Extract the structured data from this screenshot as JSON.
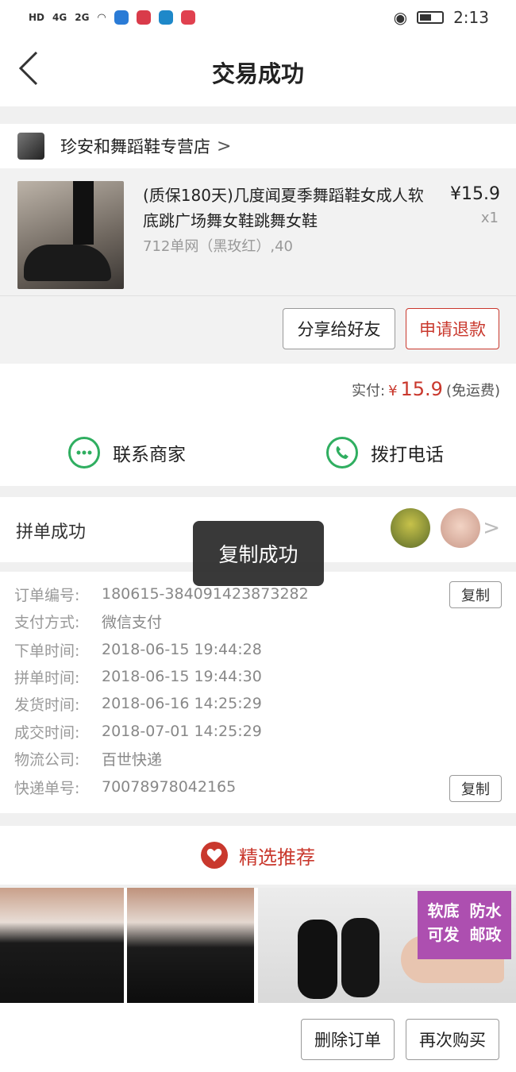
{
  "status_bar": {
    "left_tags": [
      "HD",
      "4G",
      "2G"
    ],
    "time": "2:13"
  },
  "nav": {
    "title": "交易成功"
  },
  "store": {
    "name": "珍安和舞蹈鞋专营店",
    "chevron": ">"
  },
  "product": {
    "title": "(质保180天)几度闻夏季舞蹈鞋女成人软底跳广场舞女鞋跳舞女鞋",
    "spec": "712单网（黑玫红）,40",
    "price": "¥15.9",
    "qty": "x1",
    "share_btn": "分享给好友",
    "refund_btn": "申请退款"
  },
  "payment": {
    "label": "实付:",
    "currency": "¥",
    "amount": "15.9",
    "note": "(免运费)"
  },
  "contact": {
    "merchant": "联系商家",
    "call": "拨打电话"
  },
  "group": {
    "label": "拼单成功",
    "chevron": ">"
  },
  "toast": "复制成功",
  "details": {
    "order_no_label": "订单编号:",
    "order_no": "180615-384091423873282",
    "pay_method_label": "支付方式:",
    "pay_method": "微信支付",
    "order_time_label": "下单时间:",
    "order_time": "2018-06-15 19:44:28",
    "group_time_label": "拼单时间:",
    "group_time": "2018-06-15 19:44:30",
    "ship_time_label": "发货时间:",
    "ship_time": "2018-06-16 14:25:29",
    "deal_time_label": "成交时间:",
    "deal_time": "2018-07-01 14:25:29",
    "logistics_label": "物流公司:",
    "logistics": "百世快递",
    "tracking_label": "快递单号:",
    "tracking": "70078978042165",
    "copy": "复制"
  },
  "recommend": {
    "title": "精选推荐",
    "promo_text": "软底 防水 可发 邮政"
  },
  "actions": {
    "delete": "删除订单",
    "rebuy": "再次购买"
  },
  "colors": {
    "accent_red": "#c9382d",
    "green": "#2fae60"
  }
}
